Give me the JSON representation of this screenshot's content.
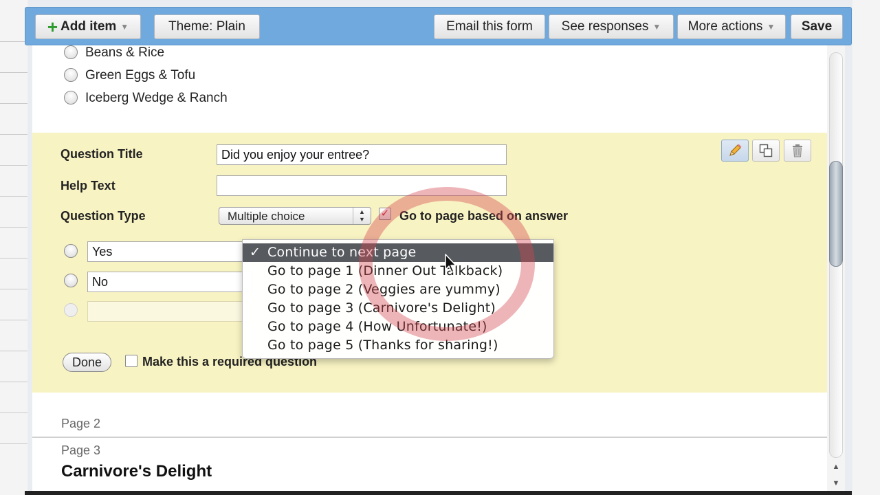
{
  "toolbar": {
    "add_item": "Add item",
    "theme": "Theme:  Plain",
    "email": "Email this form",
    "responses": "See responses",
    "more_actions": "More actions",
    "save": "Save"
  },
  "prev_question_options": [
    "Beans & Rice",
    "Green Eggs & Tofu",
    "Iceberg Wedge & Ranch"
  ],
  "editor": {
    "title_label": "Question Title",
    "title_value": "Did you enjoy your entree?",
    "help_label": "Help Text",
    "help_value": "",
    "type_label": "Question Type",
    "type_value": "Multiple choice",
    "go_to_page_checked": true,
    "go_to_page_label": "Go to page based on answer",
    "choices": [
      "Yes",
      "No"
    ],
    "done": "Done",
    "required_label": "Make this a required question",
    "required_checked": false
  },
  "page_nav_menu": {
    "items": [
      "Continue to next page",
      "Go to page 1 (Dinner Out Talkback)",
      "Go to page 2 (Veggies are yummy)",
      "Go to page 3 (Carnivore's Delight)",
      "Go to page 4 (How Unfortunate!)",
      "Go to page 5 (Thanks for sharing!)"
    ],
    "selected_index": 0,
    "check_mark": "✓"
  },
  "pages": {
    "page2": "Page 2",
    "page3": "Page 3",
    "page3_title": "Carnivore's Delight"
  },
  "icons": {
    "edit": "pencil-icon",
    "duplicate": "duplicate-icon",
    "delete": "trash-icon"
  },
  "colors": {
    "toolbar": "#6fa9dd",
    "edit_panel": "#f8f3c3",
    "menu_selected": "#575a5f",
    "highlight": "#d54650"
  }
}
